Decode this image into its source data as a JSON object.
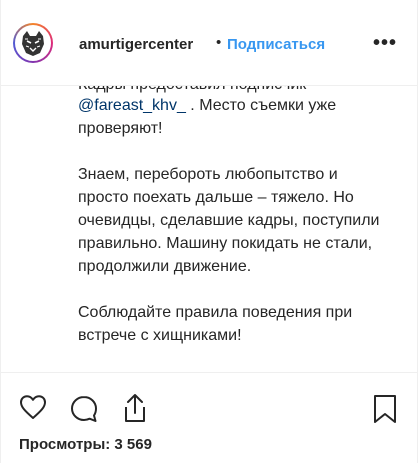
{
  "header": {
    "username": "amurtigercenter",
    "separator": "•",
    "follow_label": "Подписаться",
    "more_label": "•••"
  },
  "caption": {
    "cut_line": "Кадры предоставил подписчик",
    "line1_mention": "@fareast_khv_",
    "line1_rest": " . Место съемки уже проверяют!",
    "paragraph2": "Знаем, перебороть любопытство и просто поехать дальше – тяжело. Но очевидцы, сделавшие кадры, поступили правильно. Машину покидать не стали, продолжили движение.",
    "paragraph3": "Соблюдайте правила поведения при встрече с хищниками!"
  },
  "actions": {
    "icons": [
      "heart-icon",
      "comment-icon",
      "share-icon",
      "bookmark-icon"
    ],
    "views_label": "Просмотры: 3 569"
  },
  "colors": {
    "link": "#3897f0",
    "mention": "#003569",
    "text": "#262626",
    "border": "#efefef"
  }
}
